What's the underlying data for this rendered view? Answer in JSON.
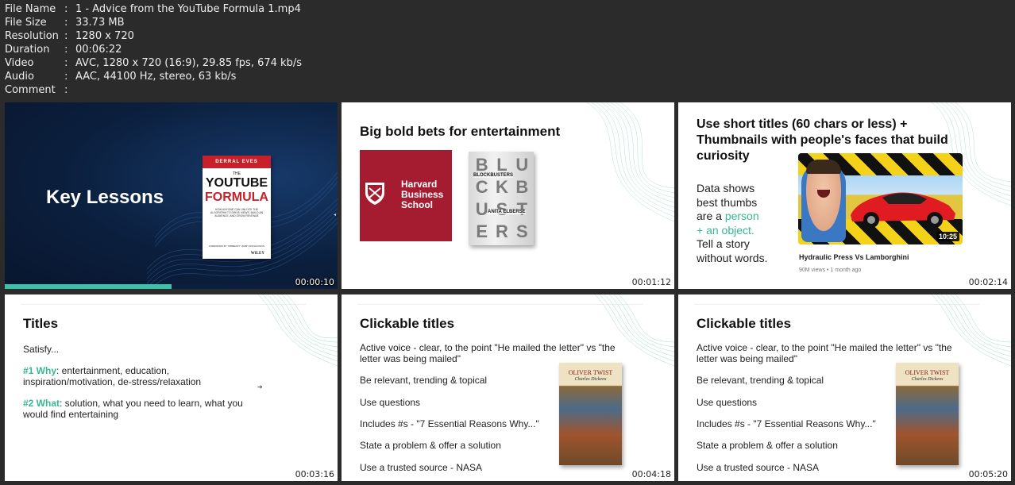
{
  "file_info": [
    {
      "key": "File Name",
      "value": "1 - Advice from the YouTube Formula 1.mp4"
    },
    {
      "key": "File Size",
      "value": "33.73 MB"
    },
    {
      "key": "Resolution",
      "value": "1280 x 720"
    },
    {
      "key": "Duration",
      "value": "00:06:22"
    },
    {
      "key": "Video",
      "value": "AVC, 1280 x 720 (16:9), 29.85 fps, 674 kb/s"
    },
    {
      "key": "Audio",
      "value": "AAC, 44100 Hz, stereo, 63 kb/s"
    },
    {
      "key": "Comment",
      "value": ""
    }
  ],
  "separator": ":",
  "thumbs": {
    "t1": {
      "title": "Key Lessons",
      "timestamp": "00:00:10",
      "progress": 0.5,
      "book": {
        "author": "DERRAL EVES",
        "the": "THE",
        "title1": "YOUTUBE",
        "title2": "FORMULA",
        "subtitle": "HOW ANYONE CAN UNLOCK THE ALGORITHM TO DRIVE VIEWS, BUILD AN AUDIENCE, AND GROW REVENUE",
        "foreword": "FOREWORD BY \"MRBEAST\" JIMMY DONALDSON",
        "publisher": "WILEY"
      }
    },
    "t2": {
      "title": "Big bold bets for entertainment",
      "timestamp": "00:01:12",
      "hbs_lines": [
        "Harvard",
        "Business",
        "School"
      ],
      "blockbusters_letters": [
        "B",
        "L",
        "U",
        "C",
        "K",
        "B",
        "U",
        "S",
        "T",
        "E",
        "R",
        "S"
      ],
      "blockbusters_title": "BLOCKBUSTERS",
      "blockbusters_author": "ANITA ELBERSE"
    },
    "t3": {
      "title": "Use short titles (60 chars or less) + Thumbnails with people's faces that build curiosity",
      "timestamp": "00:02:14",
      "text_lines": [
        "Data shows",
        "best thumbs",
        "are a",
        "person",
        "+ an object.",
        "Tell a story",
        "without words."
      ],
      "video_duration": "10:25",
      "video_title": "Hydraulic Press Vs Lamborghini",
      "video_meta": "90M views • 1 month ago"
    },
    "t4": {
      "title": "Titles",
      "timestamp": "00:03:16",
      "satisfy": "Satisfy...",
      "why_label": "#1 Why",
      "why_text": ": entertainment, education, inspiration/motivation, de-stress/relaxation",
      "what_label": "#2 What",
      "what_text": ": solution, what you need to learn, what you would find entertaining"
    },
    "t5": {
      "title": "Clickable titles",
      "timestamp": "00:04:18",
      "items": [
        "Active voice - clear, to the point \"He mailed the letter\" vs \"the letter was being mailed\"",
        "Be relevant, trending & topical",
        "Use questions",
        "Includes #s - \"7 Essential Reasons Why...\"",
        "State a problem & offer a solution",
        "Use a trusted source - NASA"
      ],
      "book_title": "OLIVER TWIST",
      "book_author": "Charles Dickens"
    },
    "t6": {
      "title": "Clickable titles",
      "timestamp": "00:05:20",
      "items": [
        "Active voice - clear, to the point \"He mailed the letter\" vs \"the letter was being mailed\"",
        "Be relevant, trending & topical",
        "Use questions",
        "Includes #s - \"7 Essential Reasons Why...\"",
        "State a problem & offer a solution",
        "Use a trusted source - NASA"
      ],
      "book_title": "OLIVER TWIST",
      "book_author": "Charles Dickens"
    }
  },
  "colors": {
    "background": "#2b2b2b",
    "accent_green": "#37b794",
    "hbs_red": "#a51c30",
    "dark_navy": "#0b1f3d",
    "progress_teal": "#3fbfa8"
  }
}
